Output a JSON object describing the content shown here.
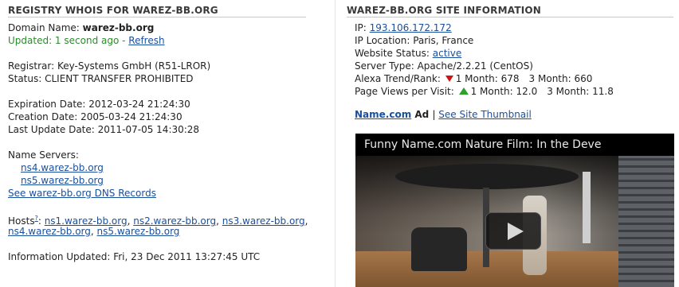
{
  "whois": {
    "title": "REGISTRY WHOIS FOR WAREZ-BB.ORG",
    "domain_label": "Domain Name: ",
    "domain_value": "warez-bb.org",
    "updated_text": "Updated: 1 second ago - ",
    "refresh_link": "Refresh",
    "registrar": "Registrar: Key-Systems GmbH (R51-LROR)",
    "status": "Status: CLIENT TRANSFER PROHIBITED",
    "expiration": "Expiration Date: 2012-03-24 21:24:30",
    "creation": "Creation Date: 2005-03-24 21:24:30",
    "last_update": "Last Update Date: 2011-07-05 14:30:28",
    "name_servers_label": "Name Servers:",
    "name_servers": [
      "ns4.warez-bb.org",
      "ns5.warez-bb.org"
    ],
    "dns_records_link": "See warez-bb.org DNS Records",
    "hosts_label": "Hosts",
    "hosts_help": "?",
    "hosts_colon": ": ",
    "hosts": [
      "ns1.warez-bb.org",
      "ns2.warez-bb.org",
      "ns3.warez-bb.org",
      "ns4.warez-bb.org",
      "ns5.warez-bb.org"
    ],
    "hosts_sep": ", ",
    "info_updated": "Information Updated: Fri, 23 Dec 2011 13:27:45 UTC"
  },
  "site": {
    "title": "WAREZ-BB.ORG SITE INFORMATION",
    "ip_label": "IP: ",
    "ip_value": "193.106.172.172",
    "ip_location": "IP Location: Paris, France",
    "website_status_label": "Website Status: ",
    "website_status_value": "active",
    "server_type": "Server Type: Apache/2.2.21 (CentOS)",
    "alexa_label": "Alexa Trend/Rank: ",
    "alexa_1m": "1 Month: 678",
    "alexa_3m": "3 Month: 660",
    "pageviews_label": "Page Views per Visit: ",
    "pageviews_1m": "1 Month: 12.0",
    "pageviews_3m": "3 Month: 11.8",
    "ad_brand": "Name.com",
    "ad_label": " Ad ",
    "ad_sep": "| ",
    "thumbnail_link": "See Site Thumbnail",
    "video_title": "Funny Name.com Nature Film: In the Deve"
  },
  "colors": {
    "link": "#1a4f9c",
    "updated_green": "#2c8a2c",
    "trend_down": "#d01414",
    "trend_up": "#2ea02e"
  },
  "icons": {
    "alexa_trend": "down-arrow-icon",
    "pageviews_trend": "up-arrow-icon",
    "video_play": "play-icon"
  }
}
